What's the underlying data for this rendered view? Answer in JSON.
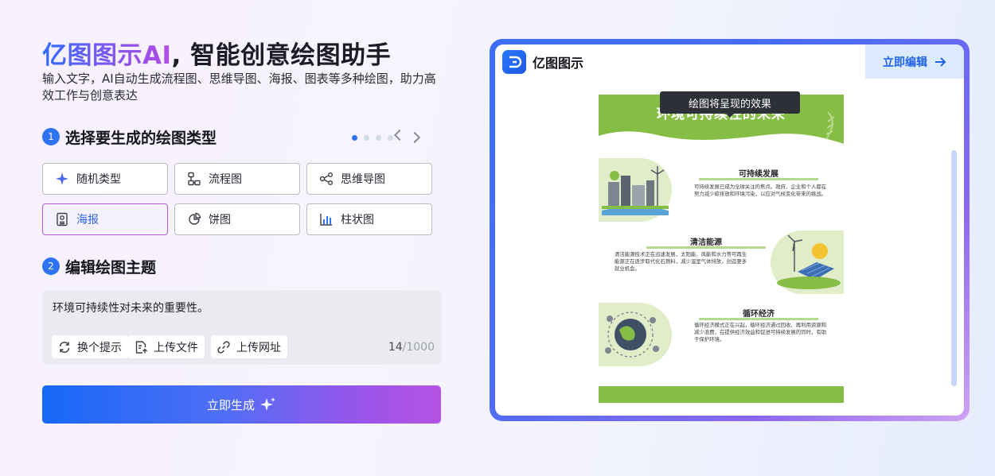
{
  "header": {
    "brand": "亿图图示AI",
    "headline_rest": ", 智能创意绘图助手",
    "subtitle": "输入文字，AI自动生成流程图、思维导图、海报、图表等多种绘图，助力高效工作与创意表达"
  },
  "step1": {
    "number": "1",
    "title": "选择要生成的绘图类型",
    "pager": {
      "current_page": 1,
      "page_count": 4
    },
    "types": [
      {
        "label": "随机类型",
        "icon": "sparkle-icon",
        "selected": false
      },
      {
        "label": "流程图",
        "icon": "flowchart-icon",
        "selected": false
      },
      {
        "label": "思维导图",
        "icon": "mindmap-icon",
        "selected": false
      },
      {
        "label": "海报",
        "icon": "poster-icon",
        "selected": true
      },
      {
        "label": "饼图",
        "icon": "pie-chart-icon",
        "selected": false
      },
      {
        "label": "柱状图",
        "icon": "bar-chart-icon",
        "selected": false
      }
    ]
  },
  "step2": {
    "number": "2",
    "title": "编辑绘图主题",
    "input_value": "环境可持续性对未来的重要性。",
    "tools": {
      "refresh": "换个提示",
      "upload_file": "上传文件",
      "upload_url": "上传网址"
    },
    "counter_current": "14",
    "counter_max": "/1000"
  },
  "generate_label": "立即生成",
  "preview": {
    "app_name": "亿图图示",
    "edit_label": "立即编辑",
    "tooltip": "绘图将呈现的效果",
    "poster": {
      "title": "环境可持续性的未来",
      "sections": [
        {
          "title": "可持续发展",
          "text": "可持续发展已成为全球关注的焦点。政府、企业和个人都在努力减少碳排放和环境污染，以应对气候变化带来的挑战。"
        },
        {
          "title": "清洁能源",
          "text": "清洁能源技术正在迅速发展，太阳能、风能和水力等可再生能源正在逐步取代化石燃料，减少温室气体排放，创造更多就业机会。"
        },
        {
          "title": "循环经济",
          "text": "循环经济模式正在兴起，循环经济通过回收、再利用资源和减少浪费，在提供经济效益和促进可持续发展的同时，有助于保护环境。"
        }
      ]
    }
  },
  "colors": {
    "accent_blue": "#2f73f5",
    "selected_border": "#b25ce4",
    "poster_green": "#86bd45",
    "poster_light_green": "#e1edc9"
  }
}
